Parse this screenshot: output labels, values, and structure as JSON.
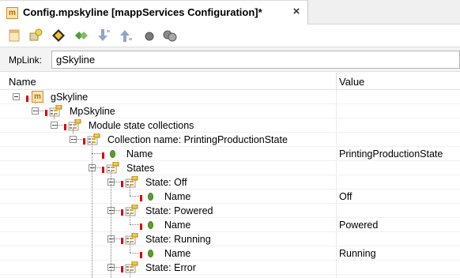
{
  "tab": {
    "icon": "m",
    "title": "Config.mpskyline [mappServices Configuration]*",
    "close": "×"
  },
  "toolbar": {
    "icons": [
      "new-config-icon",
      "add-item-icon",
      "navigate-icon",
      "link-icon",
      "sort-descending-icon",
      "sort-ascending-icon",
      "circle-icon",
      "gears-icon"
    ]
  },
  "mplink": {
    "label": "MpLink:",
    "value": "gSkyline"
  },
  "grid": {
    "header": {
      "name": "Name",
      "value": "Value"
    },
    "rows": [
      {
        "label": "gSkyline",
        "value": "",
        "icon": "m"
      },
      {
        "label": "MpSkyline",
        "value": "",
        "icon": "folder"
      },
      {
        "label": "Module state collections",
        "value": "",
        "icon": "folder"
      },
      {
        "label": "Collection name: PrintingProductionState",
        "value": "",
        "icon": "folder"
      },
      {
        "label": "Name",
        "value": "PrintingProductionState",
        "icon": "leaf"
      },
      {
        "label": "States",
        "value": "",
        "icon": "folder"
      },
      {
        "label": "State: Off",
        "value": "",
        "icon": "folder"
      },
      {
        "label": "Name",
        "value": "Off",
        "icon": "leaf"
      },
      {
        "label": "State: Powered",
        "value": "",
        "icon": "folder"
      },
      {
        "label": "Name",
        "value": "Powered",
        "icon": "leaf"
      },
      {
        "label": "State: Running",
        "value": "",
        "icon": "folder"
      },
      {
        "label": "Name",
        "value": "Running",
        "icon": "leaf"
      },
      {
        "label": "State: Error",
        "value": "",
        "icon": "folder"
      }
    ]
  },
  "colors": {
    "accent_orange": "#d08a24",
    "error_marker": "#e00000",
    "leaf_green": "#5aa02c"
  }
}
